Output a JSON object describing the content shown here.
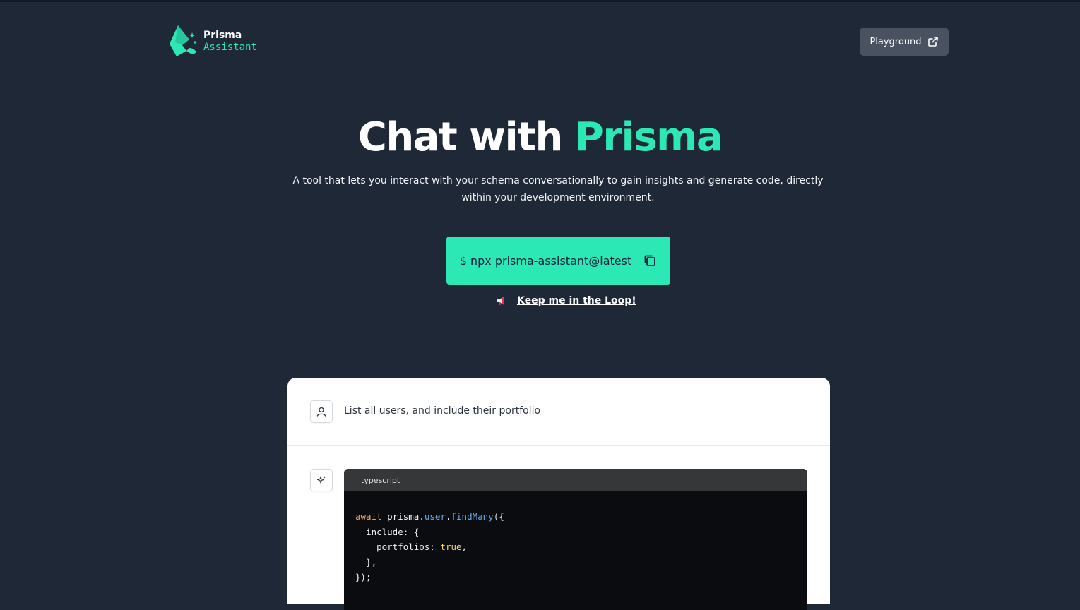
{
  "header": {
    "logo_name": "Prisma",
    "logo_sub": "Assistant",
    "playground_label": "Playground"
  },
  "hero": {
    "title_prefix": "Chat with ",
    "title_accent": "Prisma",
    "description": "A tool that lets you interact with your schema conversationally to gain insights and generate code, directly within your development environment.",
    "command": "$ npx prisma-assistant@latest",
    "loop_link": "Keep me in the Loop!"
  },
  "chat": {
    "user_message": "List all users, and include their portfolio",
    "code_language": "typescript",
    "code_lines": [
      [
        "await",
        " prisma.",
        "user",
        ".",
        "findMany",
        "({"
      ],
      [
        "  include: {"
      ],
      [
        "    portfolios: ",
        "true",
        ","
      ],
      [
        "  },"
      ],
      [
        "});"
      ]
    ]
  },
  "colors": {
    "background": "#1f2837",
    "accent": "#2ce8b5",
    "button_gray": "#4a5261"
  },
  "icons": [
    "prisma-logo-icon",
    "external-link-icon",
    "copy-icon",
    "megaphone-icon",
    "user-icon",
    "sparkle-icon"
  ]
}
